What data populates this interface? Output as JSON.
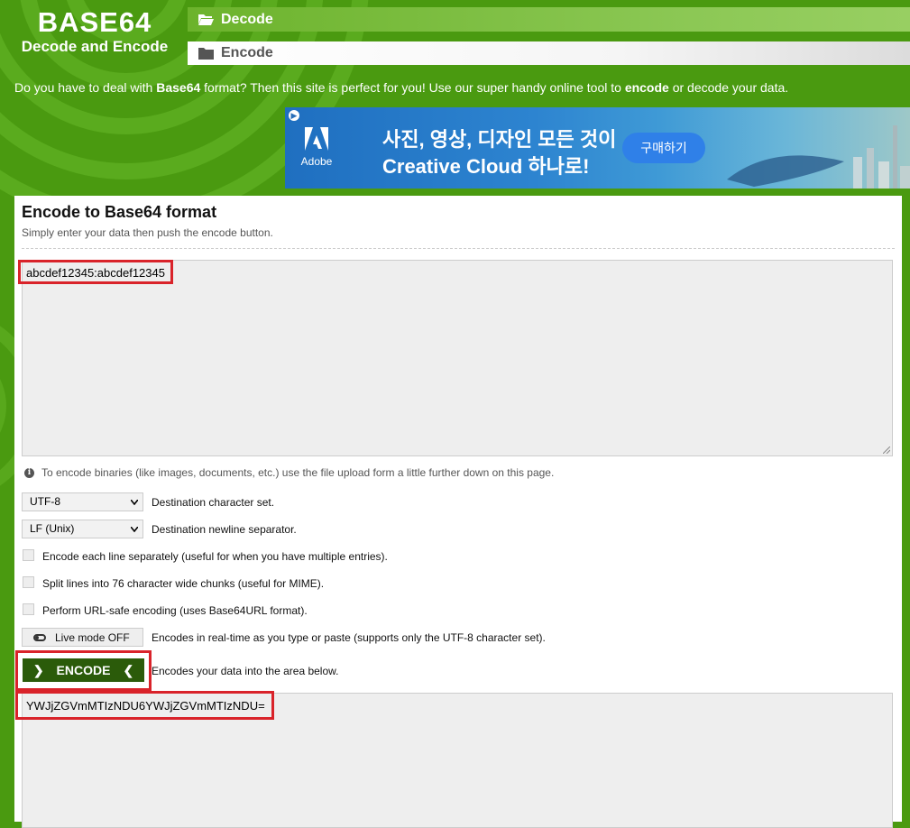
{
  "logo": {
    "title": "BASE64",
    "subtitle": "Decode and Encode"
  },
  "nav": {
    "decode_label": "Decode",
    "encode_label": "Encode"
  },
  "tagline": {
    "part1": "Do you have to deal with ",
    "bold1": "Base64",
    "part2": " format? Then this site is perfect for you! Use our super handy online tool to ",
    "bold2": "encode",
    "part3": " or decode your data."
  },
  "ad": {
    "brand": "Adobe",
    "headline1": "사진, 영상, 디자인 모든 것이",
    "headline2": "Creative Cloud 하나로!",
    "cta": "구매하기"
  },
  "encode_section": {
    "title": "Encode to Base64 format",
    "subtitle": "Simply enter your data then push the encode button.",
    "input_value": "abcdef12345:abcdef12345",
    "binary_hint": "To encode binaries (like images, documents, etc.) use the file upload form a little further down on this page.",
    "charset_value": "UTF-8",
    "charset_label": "Destination character set.",
    "newline_value": "LF (Unix)",
    "newline_label": "Destination newline separator.",
    "opt_each_line": "Encode each line separately (useful for when you have multiple entries).",
    "opt_split_lines": "Split lines into 76 character wide chunks (useful for MIME).",
    "opt_url_safe": "Perform URL-safe encoding (uses Base64URL format).",
    "live_mode_label": "Live mode OFF",
    "live_mode_desc": "Encodes in real-time as you type or paste (supports only the UTF-8 character set).",
    "encode_button": "ENCODE",
    "encode_desc": "Encodes your data into the area below.",
    "output_value": "YWJjZGVmMTIzNDU6YWJjZGVmMTIzNDU="
  },
  "colors": {
    "brand_green": "#4a9a10",
    "button_dark_green": "#2b5b0a",
    "highlight_red": "#d9232a"
  }
}
